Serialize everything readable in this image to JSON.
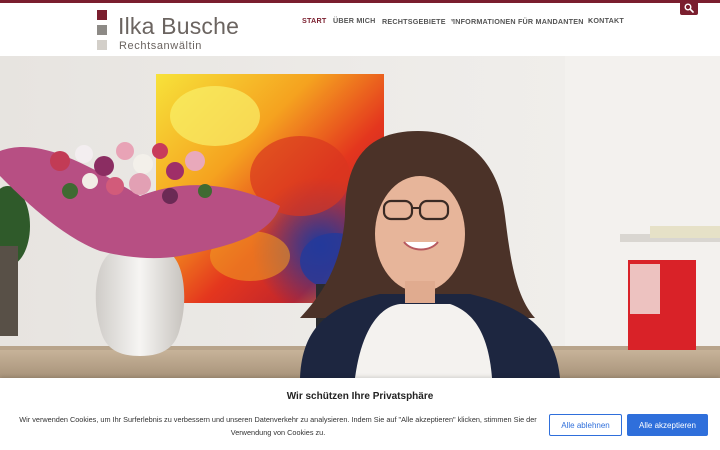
{
  "brand": {
    "name": "Ilka Busche",
    "subtitle": "Rechtsanwältin",
    "accent_color": "#7a1e2e"
  },
  "nav": {
    "items": [
      {
        "label": "START",
        "active": true
      },
      {
        "label": "ÜBER MICH",
        "active": false
      },
      {
        "label": "RECHTSGEBIETE",
        "active": false,
        "has_dropdown": true
      },
      {
        "label": "INFORMATIONEN FÜR MANDANTEN",
        "active": false,
        "has_dropdown": true
      },
      {
        "label": "KONTAKT",
        "active": false
      }
    ],
    "search_icon": "search-icon"
  },
  "hero": {
    "image_alt": "Ilka Busche"
  },
  "cookie_banner": {
    "title": "Wir schützen Ihre Privatsphäre",
    "text": "Wir verwenden Cookies, um Ihr Surferlebnis zu verbessern und unseren Datenverkehr zu analysieren. Indem Sie auf \"Alle akzeptieren\" klicken, stimmen Sie der Verwendung von Cookies zu.",
    "decline_label": "Alle ablehnen",
    "accept_label": "Alle akzeptieren",
    "button_color": "#2f6fdb"
  }
}
